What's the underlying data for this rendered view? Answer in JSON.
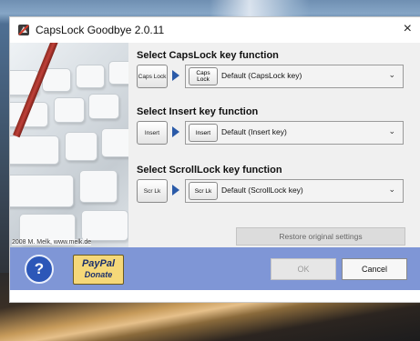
{
  "window": {
    "title": "CapsLock Goodbye 2.0.11",
    "close_label": "×"
  },
  "keyboard_image": {
    "credit": "2008 M. Melk, www.melk.de"
  },
  "sections": [
    {
      "title": "Select CapsLock key function",
      "key_label": "Caps Lock",
      "selected_key_label": "Caps Lock",
      "selected_value": "Default (CapsLock key)"
    },
    {
      "title": "Select Insert key function",
      "key_label": "Insert",
      "selected_key_label": "Insert",
      "selected_value": "Default (Insert key)"
    },
    {
      "title": "Select ScrollLock key function",
      "key_label": "Scr Lk",
      "selected_key_label": "Scr Lk",
      "selected_value": "Default (ScrollLock key)"
    }
  ],
  "restore_label": "Restore original settings",
  "bottom": {
    "help_label": "?",
    "paypal_line1": "PayPal",
    "paypal_line2": "Donate",
    "ok_label": "OK",
    "cancel_label": "Cancel"
  },
  "icons": {
    "app": "capslock-goodbye-icon",
    "chevron": "chevron-down-icon",
    "arrow": "arrow-right-icon"
  },
  "colors": {
    "bottom_bar": "#7f96d6",
    "arrow": "#2a5aa8",
    "paypal_bg": "#f5d879"
  }
}
